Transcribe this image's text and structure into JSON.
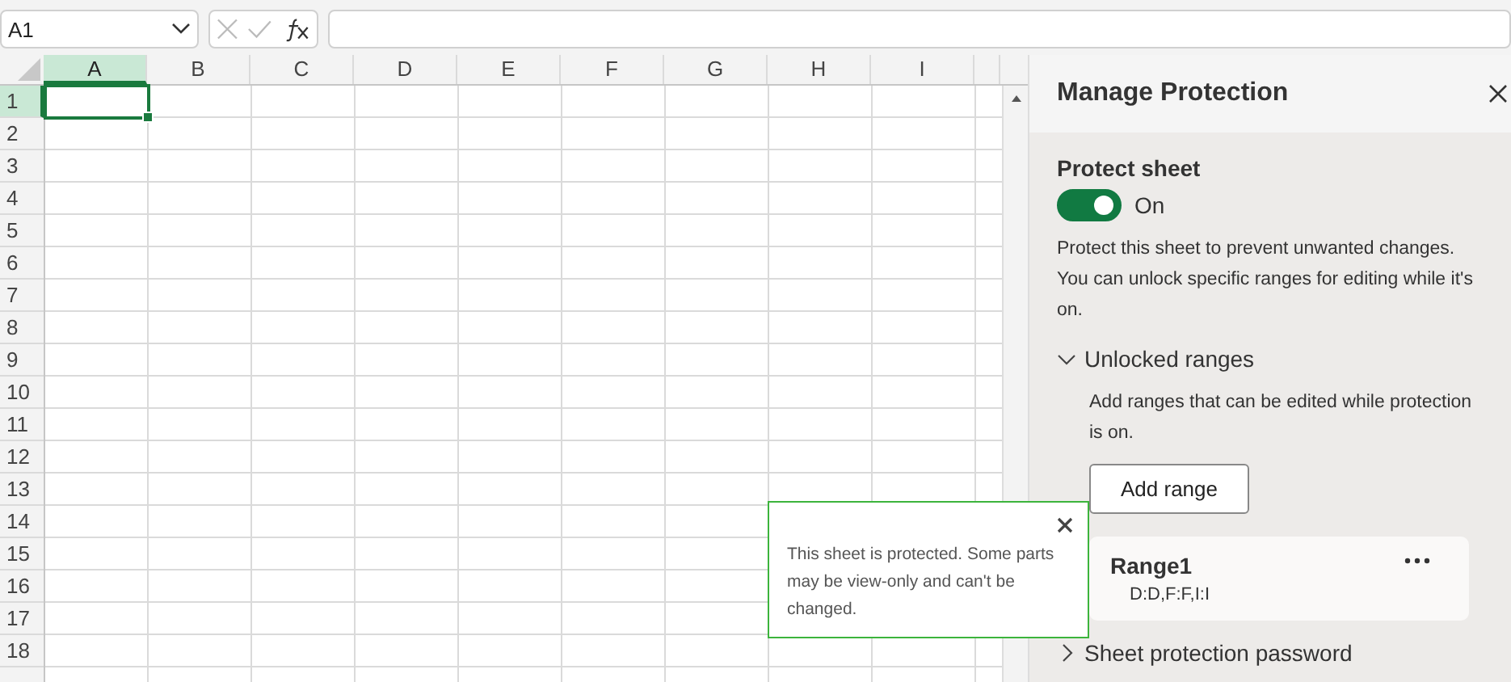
{
  "name_box": {
    "value": "A1"
  },
  "columns": [
    {
      "label": "A",
      "selected": true
    },
    {
      "label": "B",
      "selected": false
    },
    {
      "label": "C",
      "selected": false
    },
    {
      "label": "D",
      "selected": false
    },
    {
      "label": "E",
      "selected": false
    },
    {
      "label": "F",
      "selected": false
    },
    {
      "label": "G",
      "selected": false
    },
    {
      "label": "H",
      "selected": false
    },
    {
      "label": "I",
      "selected": false
    }
  ],
  "rows": [
    {
      "label": "1",
      "selected": true
    },
    {
      "label": "2",
      "selected": false
    },
    {
      "label": "3",
      "selected": false
    },
    {
      "label": "4",
      "selected": false
    },
    {
      "label": "5",
      "selected": false
    },
    {
      "label": "6",
      "selected": false
    },
    {
      "label": "7",
      "selected": false
    },
    {
      "label": "8",
      "selected": false
    },
    {
      "label": "9",
      "selected": false
    },
    {
      "label": "10",
      "selected": false
    },
    {
      "label": "11",
      "selected": false
    },
    {
      "label": "12",
      "selected": false
    },
    {
      "label": "13",
      "selected": false
    },
    {
      "label": "14",
      "selected": false
    },
    {
      "label": "15",
      "selected": false
    },
    {
      "label": "16",
      "selected": false
    },
    {
      "label": "17",
      "selected": false
    },
    {
      "label": "18",
      "selected": false
    }
  ],
  "notice": {
    "text": "This sheet is protected. Some parts may be view-only and can't be changed."
  },
  "panel": {
    "title": "Manage Protection",
    "protect_sheet": {
      "heading": "Protect sheet",
      "on": true,
      "label": "On",
      "description": "Protect this sheet to prevent unwanted changes. You can unlock specific ranges for editing while it's on."
    },
    "unlocked_ranges": {
      "heading": "Unlocked ranges",
      "expanded": true,
      "description": "Add ranges that can be edited while protection is on.",
      "button": "Add range",
      "ranges": [
        {
          "name": "Range1",
          "address": "D:D,F:F,I:I"
        }
      ]
    },
    "password_section": {
      "heading": "Sheet protection password",
      "expanded": false
    }
  }
}
